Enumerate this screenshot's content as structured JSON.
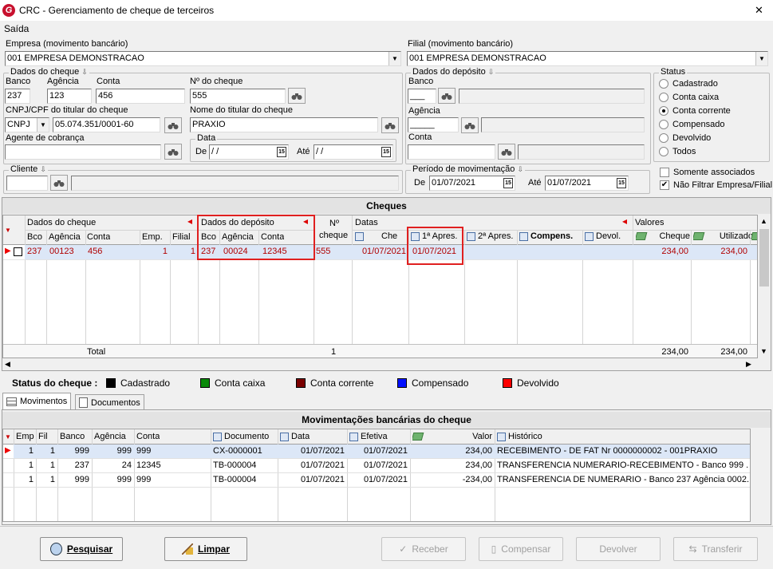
{
  "window": {
    "title": "CRC - Gerenciamento de cheque de terceiros",
    "close": "✕"
  },
  "menu": {
    "saida": "Saída"
  },
  "empresa": {
    "label": "Empresa (movimento bancário)",
    "value": "001 EMPRESA DEMONSTRACAO"
  },
  "filial": {
    "label": "Filial (movimento bancário)",
    "value": "001 EMPRESA DEMONSTRACAO"
  },
  "dados_cheque": {
    "title": "Dados do cheque",
    "banco_label": "Banco",
    "banco": "237",
    "agencia_label": "Agência",
    "agencia": "123",
    "conta_label": "Conta",
    "conta": "456",
    "num_label": "Nº do cheque",
    "num": "555",
    "cnpj_label": "CNPJ/CPF do titular do cheque",
    "cnpj_type": "CNPJ",
    "cnpj": "05.074.351/0001-60",
    "nome_label": "Nome do titular do cheque",
    "nome": "PRAXIO",
    "agente_label": "Agente de cobrança",
    "agente": "",
    "data_title": "Data",
    "de_label": "De",
    "de": " / /",
    "ate_label": "Até",
    "ate": " / /"
  },
  "dados_deposito": {
    "title": "Dados do depósito",
    "banco_label": "Banco",
    "banco": "___",
    "agencia_label": "Agência",
    "agencia": "_____",
    "conta_label": "Conta",
    "conta": ""
  },
  "status": {
    "title": "Status",
    "options": [
      "Cadastrado",
      "Conta caixa",
      "Conta corrente",
      "Compensado",
      "Devolvido",
      "Todos"
    ],
    "selected": "Conta corrente"
  },
  "cliente": {
    "label": "Cliente"
  },
  "periodo": {
    "title": "Período de movimentação",
    "de_label": "De",
    "de": "01/07/2021",
    "ate_label": "Até",
    "ate": "01/07/2021"
  },
  "checks": {
    "somente": "Somente associados",
    "nao_filtrar": "Não Filtrar Empresa/Filial"
  },
  "cheques_grid": {
    "title": "Cheques",
    "groups": {
      "dados_cheque": "Dados do cheque",
      "dados_deposito": "Dados do depósito",
      "num": "Nº",
      "num2": "cheque",
      "datas": "Datas",
      "valores": "Valores"
    },
    "columns": [
      "Bco",
      "Agência",
      "Conta",
      "Emp.",
      "Filial",
      "Bco",
      "Agência",
      "Conta",
      "Cheque",
      "1ª Apres.",
      "2ª Apres.",
      "Compens.",
      "Devol.",
      "Cheque",
      "Utilizado"
    ],
    "row": {
      "bco": "237",
      "agencia": "00123",
      "conta": "456",
      "emp": "1",
      "filial": "1",
      "dep_bco": "237",
      "dep_agencia": "00024",
      "dep_conta": "12345",
      "num": "555",
      "data_cheque": "01/07/2021",
      "apres1": "01/07/2021",
      "valor_cheque": "234,00",
      "utilizado": "234,00"
    },
    "total": {
      "label": "Total",
      "count": "1",
      "cheque": "234,00",
      "utilizado": "234,00"
    }
  },
  "legend": {
    "label": "Status do cheque :",
    "items": [
      {
        "name": "Cadastrado",
        "color": "#000000"
      },
      {
        "name": "Conta caixa",
        "color": "#0a8a0a"
      },
      {
        "name": "Conta corrente",
        "color": "#7a0000"
      },
      {
        "name": "Compensado",
        "color": "#0010ff"
      },
      {
        "name": "Devolvido",
        "color": "#ff0000"
      }
    ]
  },
  "tabs": {
    "movimentos": "Movimentos",
    "documentos": "Documentos"
  },
  "mov_grid": {
    "title": "Movimentações bancárias do cheque",
    "columns": [
      "Emp",
      "Fil",
      "Banco",
      "Agência",
      "Conta",
      "Documento",
      "Data",
      "Efetiva",
      "Valor",
      "Histórico"
    ],
    "rows": [
      {
        "emp": "1",
        "fil": "1",
        "banco": "999",
        "agencia": "999",
        "conta": "999",
        "documento": "CX-0000001",
        "data": "01/07/2021",
        "efetiva": "01/07/2021",
        "valor": "234,00",
        "historico": "RECEBIMENTO - DE FAT Nr 0000000002 - 001PRAXIO"
      },
      {
        "emp": "1",
        "fil": "1",
        "banco": "237",
        "agencia": "24",
        "conta": "12345",
        "documento": "TB-000004",
        "data": "01/07/2021",
        "efetiva": "01/07/2021",
        "valor": "234,00",
        "historico": "TRANSFERENCIA NUMERARIO-RECEBIMENTO - Banco 999 ..."
      },
      {
        "emp": "1",
        "fil": "1",
        "banco": "999",
        "agencia": "999",
        "conta": "999",
        "documento": "TB-000004",
        "data": "01/07/2021",
        "efetiva": "01/07/2021",
        "valor": "-234,00",
        "historico": "TRANSFERENCIA DE NUMERARIO - Banco 237 Agência 0002..."
      }
    ]
  },
  "buttons": {
    "pesquisar": "Pesquisar",
    "limpar": "Limpar",
    "receber": "Receber",
    "compensar": "Compensar",
    "devolver": "Devolver",
    "transferir": "Transferir"
  }
}
